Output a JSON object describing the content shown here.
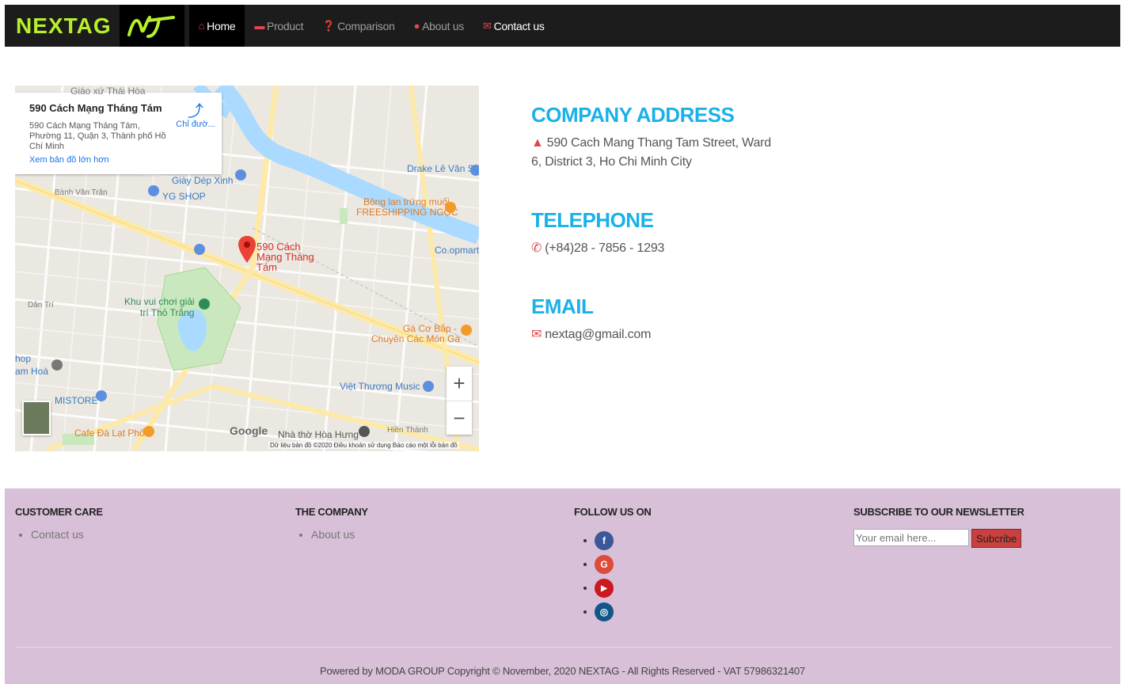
{
  "navbar": {
    "brand": "NEXTAG",
    "logo_glyph": "NT",
    "items": [
      {
        "icon": "home-icon",
        "label": "Home"
      },
      {
        "icon": "briefcase-icon",
        "label": "Product"
      },
      {
        "icon": "question-circle-icon",
        "label": "Comparison"
      },
      {
        "icon": "user-icon",
        "label": "About us"
      },
      {
        "icon": "envelope-icon",
        "label": "Contact us"
      }
    ]
  },
  "map": {
    "card_title": "590 Cách Mạng Tháng Tám",
    "card_address": "590 Cách Mạng Tháng Tám, Phường 11, Quận 3, Thành phố Hồ Chí Minh",
    "card_link": "Xem bản đồ lớn hơn",
    "directions": "Chỉ đườ...",
    "pin_label": "590 Cách Mạng Tháng Tám",
    "labels": {
      "giao_xu": "Giáo xứ Thái Hòa",
      "giay_dep": "Giày Dép Xinh",
      "yg_shop": "YG SHOP",
      "banh_van_tran": "Bành Văn Trân",
      "drake": "Drake Lê Văn Sỹ",
      "bong_lan": "Bông lan trứng muối",
      "freeshipping": "FREESHIPPING NGỌC",
      "coopmart": "Co.opmart",
      "khu_vui_1": "Khu vui chơi giải",
      "khu_vui_2": "trí Thỏ Trắng",
      "ga_co_bap_1": "Gà Cơ Bắp -",
      "ga_co_bap_2": "Chuyên Các Món Gà",
      "op": "hop",
      "am_hoa": "am Hoà",
      "viet_thuong": "Việt Thương Music",
      "mistore": "MISTORE",
      "cafe": "Cafe Đà Lạt Phố",
      "nha_tho": "Nhà thờ Hòa Hưng",
      "dan_tri": "Dân Trí",
      "hien_thanh": "Hiền Thành"
    },
    "google": "Google",
    "attribution": "Dữ liệu bản đồ ©2020   Điều khoản sử dụng   Báo cáo một lỗi bản đồ"
  },
  "contact": {
    "address_title": "COMPANY ADDRESS",
    "address": "590 Cach Mang Thang Tam Street, Ward 6, District 3, Ho Chi Minh City",
    "phone_title": "TELEPHONE",
    "phone": "(+84)28 - 7856 - 1293",
    "email_title": "EMAIL",
    "email": "nextag@gmail.com"
  },
  "footer": {
    "customer_care": {
      "title": "CUSTOMER CARE",
      "items": [
        "Contact us"
      ]
    },
    "company": {
      "title": "THE COMPANY",
      "items": [
        "About us"
      ]
    },
    "follow": {
      "title": "FOLLOW US ON",
      "icons": [
        {
          "name": "facebook-icon",
          "glyph": "f",
          "color": "#3b5998"
        },
        {
          "name": "google-icon",
          "glyph": "G",
          "color": "#dd4b39"
        },
        {
          "name": "youtube-icon",
          "glyph": "▶",
          "color": "#cc181e"
        },
        {
          "name": "instagram-icon",
          "glyph": "◎",
          "color": "#125688"
        }
      ]
    },
    "newsletter": {
      "title": "SUBSCRIBE TO OUR NEWSLETTER",
      "placeholder": "Your email here...",
      "button": "Subcribe"
    },
    "copyright": "Powered by MODA GROUP Copyright © November, 2020 NEXTAG - All Rights Reserved - VAT 57986321407"
  }
}
